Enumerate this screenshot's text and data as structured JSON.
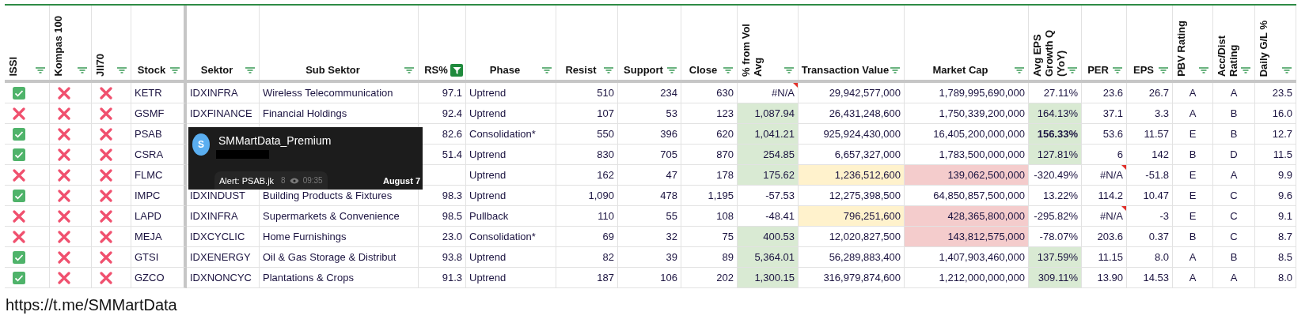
{
  "columns": [
    {
      "label": "ISSI",
      "kind": "flag",
      "vertical": true,
      "filter_active": false
    },
    {
      "label": "Kompas 100",
      "kind": "flag",
      "vertical": true,
      "filter_active": false
    },
    {
      "label": "JII70",
      "kind": "flag",
      "vertical": true,
      "filter_active": false
    },
    {
      "label": "Stock",
      "kind": "text",
      "vertical": false,
      "filter_active": false
    },
    {
      "label": "Sektor",
      "kind": "text",
      "vertical": false,
      "filter_active": false
    },
    {
      "label": "Sub Sektor",
      "kind": "text",
      "vertical": false,
      "filter_active": false
    },
    {
      "label": "RS%",
      "kind": "number",
      "vertical": false,
      "filter_active": true
    },
    {
      "label": "Phase",
      "kind": "text",
      "vertical": false,
      "filter_active": false
    },
    {
      "label": "Resist",
      "kind": "number",
      "vertical": false,
      "filter_active": false
    },
    {
      "label": "Support",
      "kind": "number",
      "vertical": false,
      "filter_active": false
    },
    {
      "label": "Close",
      "kind": "number",
      "vertical": false,
      "filter_active": false
    },
    {
      "label": "% from Vol Avg",
      "kind": "number",
      "vertical": true,
      "filter_active": false
    },
    {
      "label": "Transaction Value",
      "kind": "number",
      "vertical": false,
      "filter_active": false
    },
    {
      "label": "Market Cap",
      "kind": "number",
      "vertical": false,
      "filter_active": false
    },
    {
      "label": "Avg EPS Growth Q (YoY)",
      "kind": "number",
      "vertical": true,
      "filter_active": false
    },
    {
      "label": "PER",
      "kind": "number",
      "vertical": false,
      "filter_active": false
    },
    {
      "label": "EPS",
      "kind": "number",
      "vertical": false,
      "filter_active": false
    },
    {
      "label": "PBV Rating",
      "kind": "grade",
      "vertical": true,
      "filter_active": false
    },
    {
      "label": "Acc/Dist Rating",
      "kind": "grade",
      "vertical": true,
      "filter_active": false
    },
    {
      "label": "Daily G/L %",
      "kind": "number",
      "vertical": true,
      "filter_active": false
    }
  ],
  "rows": [
    {
      "flags": [
        true,
        false,
        false
      ],
      "cells": [
        "KETR",
        "IDXINFRA",
        "Wireless Telecommunication",
        "97.1",
        "Uptrend",
        "510",
        "234",
        "630",
        {
          "text": "#N/A",
          "comment": true
        },
        "29,942,577,000",
        "1,789,995,690,000",
        "27.11%",
        "23.6",
        "26.7",
        "A",
        "A",
        "23.5"
      ]
    },
    {
      "flags": [
        false,
        false,
        false
      ],
      "cells": [
        "GSMF",
        "IDXFINANCE",
        "Financial Holdings",
        "92.4",
        "Uptrend",
        "107",
        "53",
        "123",
        {
          "text": "1,087.94",
          "color": "#d9ead3"
        },
        "26,431,248,600",
        "1,750,339,200,000",
        {
          "text": "164.13%",
          "color": "#d9ead3"
        },
        "37.1",
        "3.3",
        "A",
        "B",
        "16.0"
      ]
    },
    {
      "flags": [
        true,
        false,
        false
      ],
      "cells": [
        "PSAB",
        null,
        null,
        "82.6",
        "Consolidation*",
        "550",
        "396",
        "620",
        {
          "text": "1,041.21",
          "color": "#d9ead3"
        },
        "925,924,430,000",
        "16,405,200,000,000",
        {
          "text": "156.33%",
          "color": "#d9ead3",
          "bold": true
        },
        "53.6",
        "11.57",
        "E",
        "B",
        "12.7"
      ]
    },
    {
      "flags": [
        true,
        false,
        false
      ],
      "cells": [
        "CSRA",
        null,
        null,
        "51.4",
        "Uptrend",
        "830",
        "705",
        "870",
        {
          "text": "254.85",
          "color": "#d9ead3"
        },
        "6,657,327,000",
        "1,783,500,000,000",
        {
          "text": "127.81%",
          "color": "#d9ead3"
        },
        "6",
        "142",
        "B",
        "D",
        "11.5"
      ]
    },
    {
      "flags": [
        false,
        false,
        false
      ],
      "cells": [
        "FLMC",
        null,
        null,
        null,
        "Uptrend",
        "162",
        "47",
        "178",
        {
          "text": "175.62",
          "color": "#d9ead3"
        },
        {
          "text": "1,236,512,600",
          "color": "#fff2cc"
        },
        {
          "text": "139,062,500,000",
          "color": "#f4cccc"
        },
        "-320.49%",
        {
          "text": "#N/A",
          "comment": true
        },
        "-51.8",
        "E",
        "A",
        "9.9"
      ]
    },
    {
      "flags": [
        true,
        false,
        false
      ],
      "cells": [
        "IMPC",
        "IDXINDUST",
        "Building Products & Fixtures",
        "98.3",
        "Uptrend",
        "1,090",
        "478",
        "1,195",
        "-57.53",
        "12,275,398,500",
        "64,850,857,500,000",
        "13.22%",
        "114.2",
        "10.47",
        "E",
        "C",
        "9.6"
      ]
    },
    {
      "flags": [
        false,
        false,
        false
      ],
      "cells": [
        "LAPD",
        "IDXINFRA",
        "Supermarkets & Convenience",
        "98.5",
        "Pullback",
        "110",
        "55",
        "108",
        "-48.41",
        {
          "text": "796,251,600",
          "color": "#fff2cc"
        },
        {
          "text": "428,365,800,000",
          "color": "#f4cccc"
        },
        "-295.82%",
        {
          "text": "#N/A",
          "comment": true
        },
        "-3",
        "E",
        "C",
        "9.1"
      ]
    },
    {
      "flags": [
        false,
        false,
        false
      ],
      "cells": [
        "MEJA",
        "IDXCYCLIC",
        "Home Furnishings",
        "23.0",
        "Consolidation*",
        "69",
        "32",
        "75",
        {
          "text": "400.53",
          "color": "#d9ead3"
        },
        "12,020,827,500",
        {
          "text": "143,812,575,000",
          "color": "#f4cccc"
        },
        "-78.07%",
        "203.6",
        "0.37",
        "B",
        "C",
        "8.7"
      ]
    },
    {
      "flags": [
        true,
        false,
        false
      ],
      "cells": [
        "GTSI",
        "IDXENERGY",
        "Oil & Gas Storage & Distribut",
        "93.8",
        "Uptrend",
        "82",
        "39",
        "89",
        {
          "text": "5,364.01",
          "color": "#d9ead3"
        },
        "56,289,883,400",
        "1,407,903,460,000",
        {
          "text": "137.59%",
          "color": "#d9ead3"
        },
        "11.15",
        "8.0",
        "A",
        "B",
        "8.5"
      ]
    },
    {
      "flags": [
        true,
        false,
        false
      ],
      "cells": [
        "GZCO",
        "IDXNONCYC",
        "Plantations & Crops",
        "91.3",
        "Uptrend",
        "187",
        "106",
        "202",
        {
          "text": "1,300.15",
          "color": "#d9ead3"
        },
        "316,979,874,600",
        "1,212,000,000,000",
        {
          "text": "309.11%",
          "color": "#d9ead3"
        },
        "13.90",
        "14.53",
        "A",
        "A",
        "8.0"
      ]
    }
  ],
  "notification": {
    "avatar_letter": "S",
    "sender": "SMMartData_Premium",
    "message": "Alert: PSAB.jk",
    "views": "8",
    "time": "09:35",
    "date": "August 7"
  },
  "footer_link": "https://t.me/SMMartData"
}
